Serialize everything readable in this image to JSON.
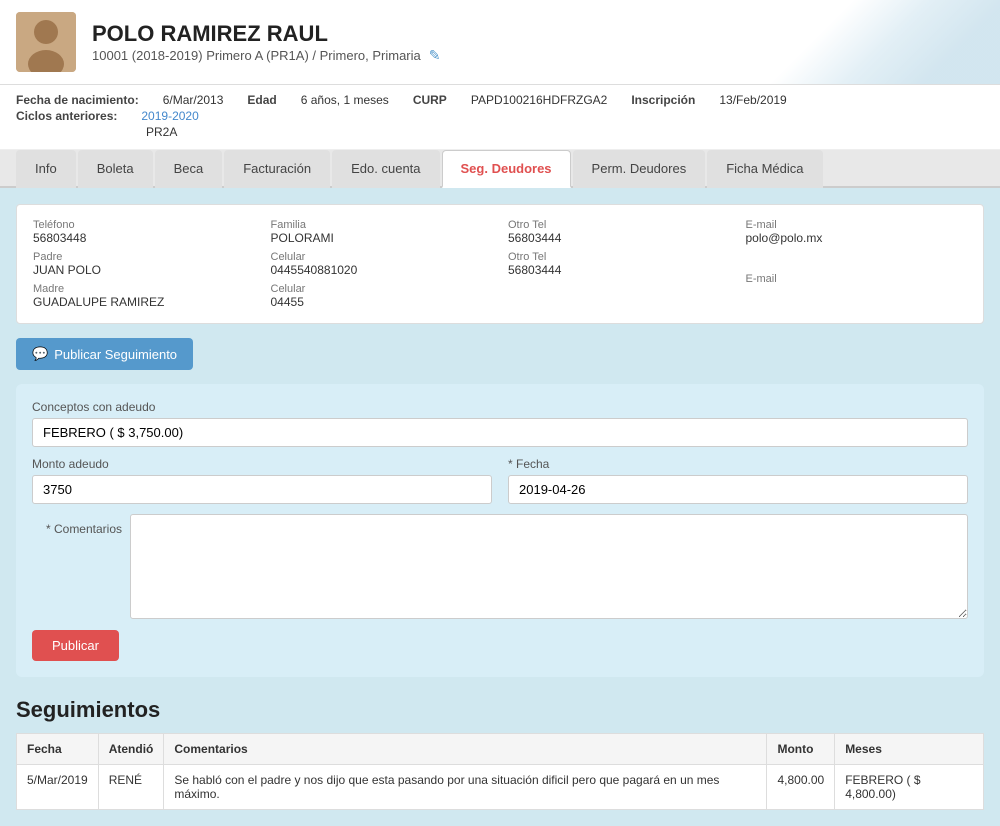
{
  "header": {
    "name": "POLO RAMIREZ RAUL",
    "subtitle": "10001 (2018-2019) Primero A (PR1A) / Primero, Primaria",
    "edit_icon": "✎"
  },
  "meta": {
    "birth_label": "Fecha de nacimiento:",
    "birth_value": "6/Mar/2013",
    "age_label": "Edad",
    "age_value": "6 años, 1 meses",
    "curp_label": "CURP",
    "curp_value": "PAPD100216HDFRZGA2",
    "inscripcion_label": "Inscripción",
    "inscripcion_value": "13/Feb/2019",
    "ciclos_label": "Ciclos anteriores:",
    "ciclos_link": "2019-2020",
    "ciclos_sub": "PR2A"
  },
  "tabs": [
    {
      "label": "Info",
      "active": false
    },
    {
      "label": "Boleta",
      "active": false
    },
    {
      "label": "Beca",
      "active": false
    },
    {
      "label": "Facturación",
      "active": false
    },
    {
      "label": "Edo. cuenta",
      "active": false
    },
    {
      "label": "Seg. Deudores",
      "active": true
    },
    {
      "label": "Perm. Deudores",
      "active": false
    },
    {
      "label": "Ficha Médica",
      "active": false
    }
  ],
  "contact": {
    "telefono_label": "Teléfono",
    "telefono_value": "56803448",
    "familia_label": "Familia",
    "familia_value": "POLORAMI",
    "otro_tel_label": "Otro Tel",
    "otro_tel_value": "56803444",
    "email_label": "E-mail",
    "email_value": "polo@polo.mx",
    "padre_label": "Padre",
    "padre_value": "JUAN POLO",
    "celular_padre_label": "Celular",
    "celular_padre_value": "0445540881020",
    "otro_tel2_label": "Otro Tel",
    "otro_tel2_value": "56803444",
    "email2_label": "E-mail",
    "email2_value": "",
    "madre_label": "Madre",
    "madre_value": "GUADALUPE RAMIREZ",
    "celular_madre_label": "Celular",
    "celular_madre_value": "04455"
  },
  "publish_button": "Publicar Seguimiento",
  "form": {
    "conceptos_label": "Conceptos con adeudo",
    "conceptos_value": "FEBRERO ( $ 3,750.00)",
    "monto_label": "Monto adeudo",
    "monto_value": "3750",
    "fecha_label": "* Fecha",
    "fecha_value": "2019-04-26",
    "comentarios_label": "* Comentarios",
    "comentarios_value": "",
    "submit_label": "Publicar"
  },
  "seguimientos": {
    "title": "Seguimientos",
    "table": {
      "headers": [
        "Fecha",
        "Atendió",
        "Comentarios",
        "Monto",
        "Meses"
      ],
      "rows": [
        {
          "fecha": "5/Mar/2019",
          "atendio": "RENÉ",
          "comentarios": "Se habló con el padre y nos dijo que esta pasando por una situación dificil pero que pagará en un mes máximo.",
          "monto": "4,800.00",
          "meses": "FEBRERO ( $ 4,800.00)"
        }
      ]
    }
  }
}
